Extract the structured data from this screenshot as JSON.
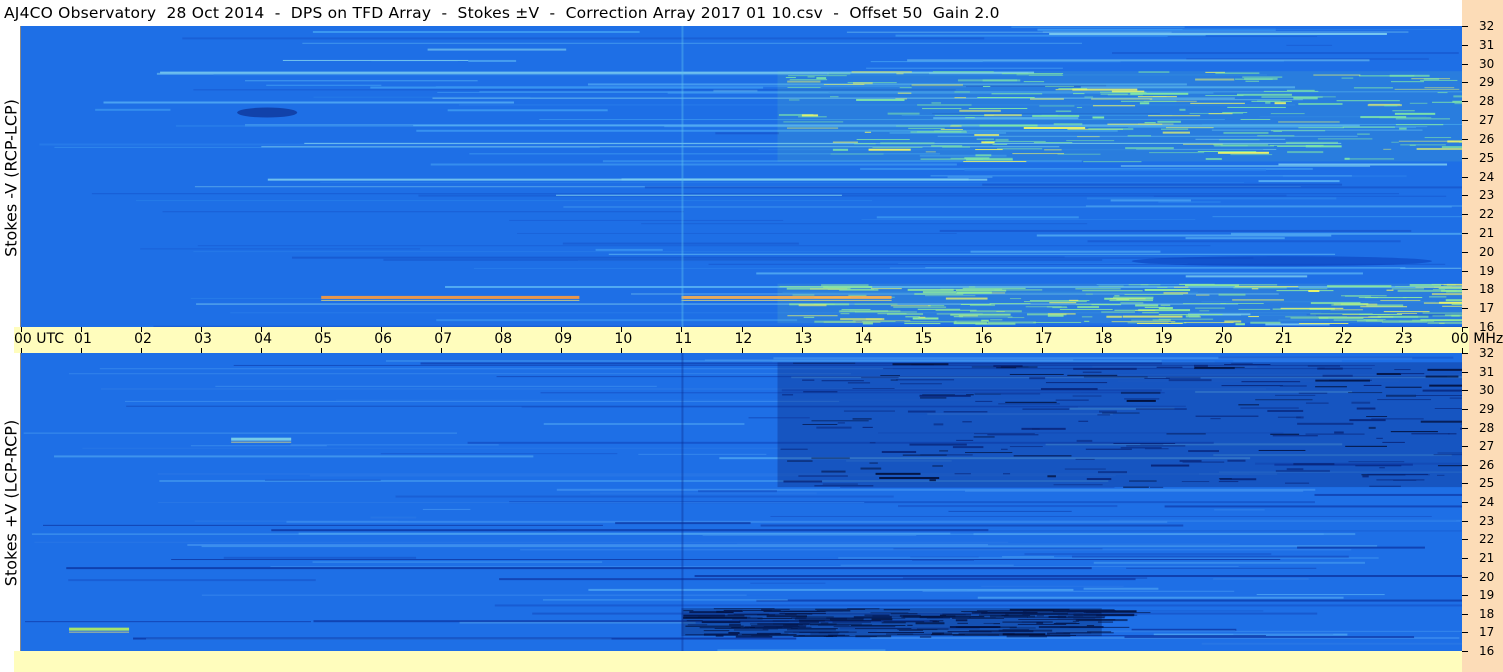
{
  "title": "AJ4CO Observatory  28 Oct 2014  -  DPS on TFD Array  -  Stokes ±V  -  Correction Array 2017 01 10.csv  -  Offset 50  Gain 2.0",
  "colors": {
    "freq_strip": "#fcdcb7",
    "time_axis": "#fffdbd",
    "base_blue": "#1e6fe6",
    "dark_blue": "#0d3fb0"
  },
  "chart_data": [
    {
      "type": "heatmap",
      "ylabel": "Stokes -V (RCP-LCP)",
      "x_ticks": [
        "00 UTC",
        "01",
        "02",
        "03",
        "04",
        "05",
        "06",
        "07",
        "08",
        "09",
        "10",
        "11",
        "12",
        "13",
        "14",
        "15",
        "16",
        "17",
        "18",
        "19",
        "20",
        "21",
        "22",
        "23",
        "00 MHz"
      ],
      "x_range_hours": [
        0,
        24
      ],
      "y_ticks": [
        16,
        17,
        18,
        19,
        20,
        21,
        22,
        23,
        24,
        25,
        26,
        27,
        28,
        29,
        30,
        31,
        32
      ],
      "y_range_mhz": [
        16,
        32
      ],
      "features": [
        {
          "kind": "noise_band",
          "t_start": 12.6,
          "t_end": 24,
          "f_low": 24.8,
          "f_high": 29.6,
          "intensity": "high",
          "color": "#7fe6a8"
        },
        {
          "kind": "noise_band",
          "t_start": 12.6,
          "t_end": 24,
          "f_low": 16.2,
          "f_high": 18.3,
          "intensity": "high",
          "color": "#8ee89e"
        },
        {
          "kind": "hot_line",
          "t_start": 5.0,
          "t_end": 9.3,
          "f": 17.6,
          "color": "#ff9a3a"
        },
        {
          "kind": "hot_line",
          "t_start": 11.0,
          "t_end": 14.5,
          "f": 17.6,
          "color": "#ffb04a"
        },
        {
          "kind": "dark_patch",
          "t_start": 3.6,
          "t_end": 4.6,
          "f": 27.4,
          "color": "#0a2a8a"
        },
        {
          "kind": "dark_patch",
          "t_start": 18.5,
          "t_end": 23.5,
          "f": 19.5,
          "color": "#0d45c2"
        }
      ]
    },
    {
      "type": "heatmap",
      "ylabel": "Stokes +V (LCP-RCP)",
      "x_ticks": [
        "00 UTC",
        "01",
        "02",
        "03",
        "04",
        "05",
        "06",
        "07",
        "08",
        "09",
        "10",
        "11",
        "12",
        "13",
        "14",
        "15",
        "16",
        "17",
        "18",
        "19",
        "20",
        "21",
        "22",
        "23",
        "00 MHz"
      ],
      "x_range_hours": [
        0,
        24
      ],
      "y_ticks": [
        16,
        17,
        18,
        19,
        20,
        21,
        22,
        23,
        24,
        25,
        26,
        27,
        28,
        29,
        30,
        31,
        32
      ],
      "y_range_mhz": [
        16,
        32
      ],
      "features": [
        {
          "kind": "dark_band",
          "t_start": 12.6,
          "t_end": 24,
          "f_low": 24.8,
          "f_high": 31.5,
          "color": "#08257a"
        },
        {
          "kind": "dark_band",
          "t_start": 11.0,
          "t_end": 18.0,
          "f_low": 16.8,
          "f_high": 18.3,
          "color": "#041a55"
        },
        {
          "kind": "cyan_line",
          "t_start": 0.8,
          "t_end": 1.8,
          "f": 17.2,
          "color": "#b7f15a"
        },
        {
          "kind": "cyan_line",
          "t_start": 3.5,
          "t_end": 4.5,
          "f": 27.4,
          "color": "#7fd5e8"
        }
      ]
    }
  ]
}
